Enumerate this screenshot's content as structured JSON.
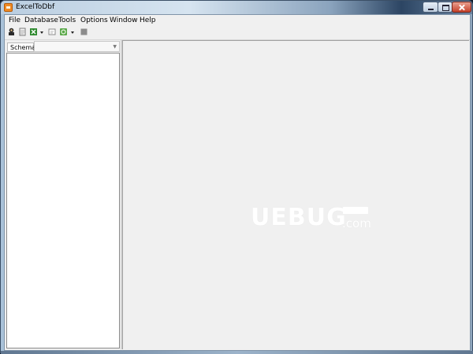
{
  "window": {
    "title": "ExcelToDbf",
    "controls": {
      "minimize": "minimize-icon",
      "maximize": "maximize-icon",
      "close": "close-icon"
    }
  },
  "menubar": {
    "items": [
      {
        "label": "File"
      },
      {
        "label": "Database"
      },
      {
        "label": "Tools"
      },
      {
        "label": "Options"
      },
      {
        "label": "Window"
      },
      {
        "label": "Help"
      }
    ]
  },
  "toolbar": {
    "buttons": [
      {
        "icon": "connect-icon"
      },
      {
        "icon": "new-document-icon"
      },
      {
        "icon": "excel-icon",
        "dropdown": true
      },
      {
        "icon": "export-icon"
      },
      {
        "icon": "refresh-icon",
        "dropdown": true
      },
      {
        "icon": "stop-icon"
      }
    ]
  },
  "schema_panel": {
    "tab_label": "Schema",
    "selected_value": ""
  },
  "watermark": {
    "main": "UEBUG",
    "suffix": ".com"
  },
  "colors": {
    "client_bg": "#f0f0f0",
    "tree_bg": "#ffffff",
    "title_gradient_dark": "#2c4563"
  }
}
